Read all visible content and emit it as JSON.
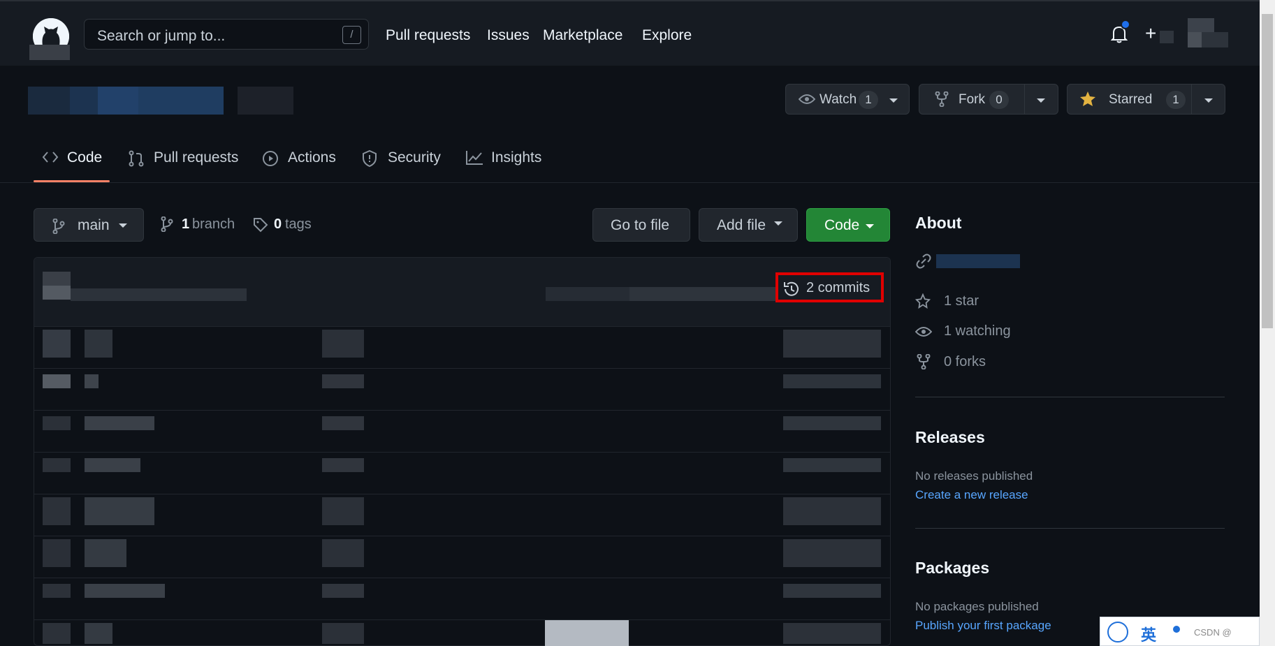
{
  "header": {
    "search_placeholder": "Search or jump to...",
    "search_shortcut": "/",
    "nav": [
      "Pull requests",
      "Issues",
      "Marketplace",
      "Explore"
    ]
  },
  "repo_actions": {
    "watch_label": "Watch",
    "watch_count": "1",
    "fork_label": "Fork",
    "fork_count": "0",
    "starred_label": "Starred",
    "starred_count": "1"
  },
  "tabs": [
    "Code",
    "Pull requests",
    "Actions",
    "Security",
    "Insights"
  ],
  "toolbar": {
    "branch_name": "main",
    "branch_count": "1",
    "branch_word": "branch",
    "tag_count": "0",
    "tag_word": "tags",
    "go_to_file": "Go to file",
    "add_file": "Add file",
    "code": "Code"
  },
  "commits_label": "2 commits",
  "about": {
    "title": "About",
    "stars": "1 star",
    "watching": "1 watching",
    "forks": "0 forks"
  },
  "releases": {
    "title": "Releases",
    "empty": "No releases published",
    "link": "Create a new release"
  },
  "packages": {
    "title": "Packages",
    "empty": "No packages published",
    "link": "Publish your first package"
  },
  "ime_bar": {
    "mode": "英",
    "watermark": "CSDN @"
  },
  "colors": {
    "bg": "#0d1117",
    "header": "#161b22",
    "accent_green": "#238636",
    "link": "#58a6ff",
    "highlight": "#e00000",
    "tab_underline": "#f78166"
  }
}
